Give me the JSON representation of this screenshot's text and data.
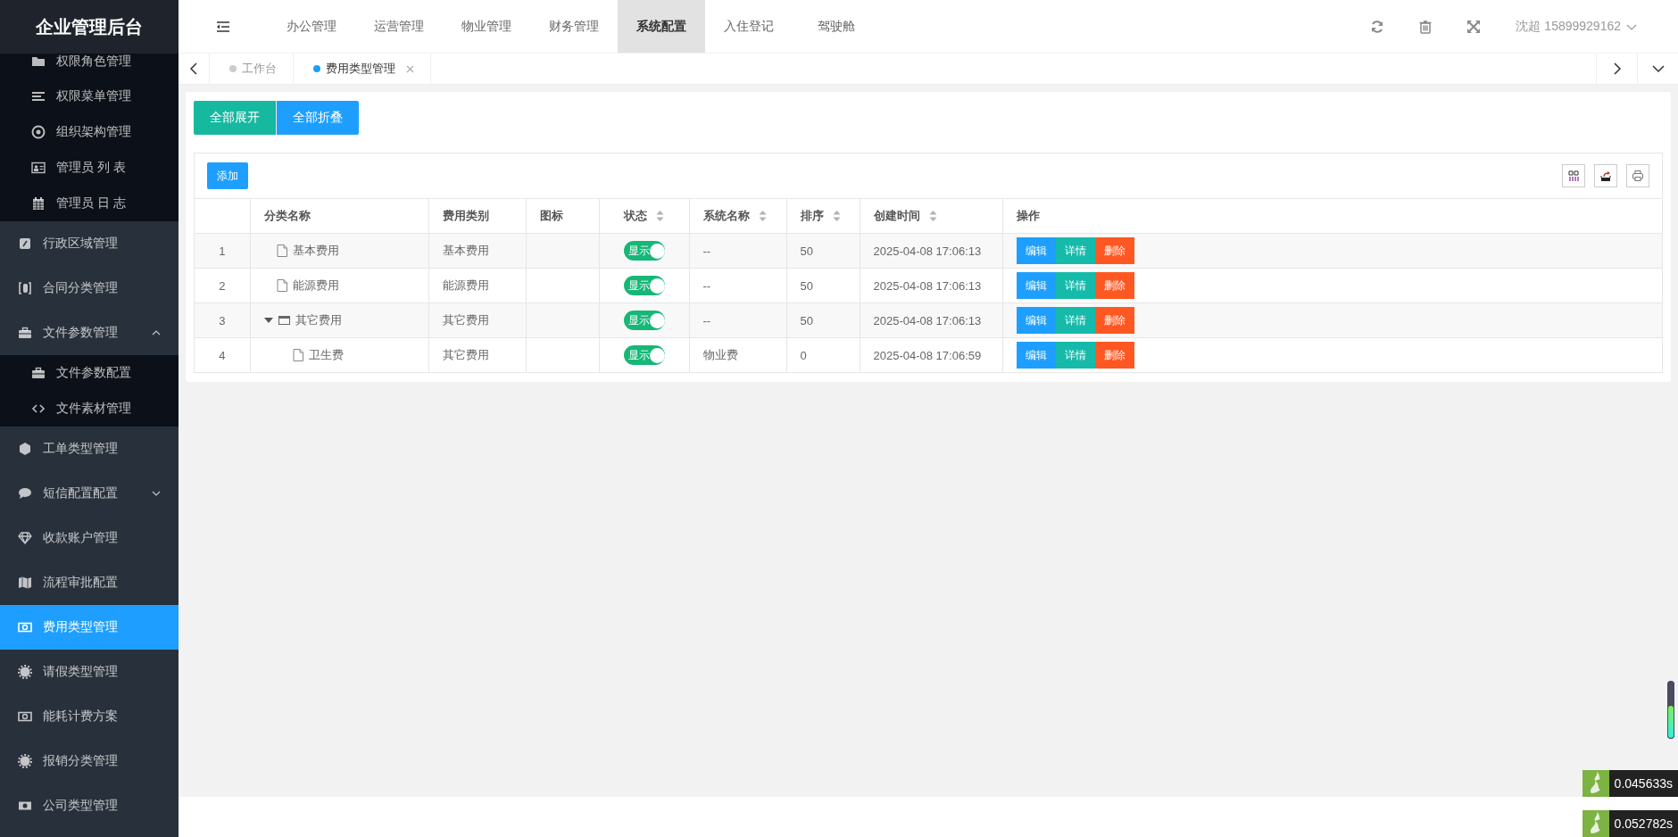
{
  "app": {
    "title": "企业管理后台"
  },
  "sidebar": {
    "submenu_items": [
      {
        "label": "权限角色管理",
        "selected": false
      },
      {
        "label": "权限菜单管理",
        "selected": false
      },
      {
        "label": "组织架构管理",
        "selected": false
      },
      {
        "label": "管理员 列 表",
        "selected": false
      },
      {
        "label": "管理员 日 志",
        "selected": false
      }
    ],
    "items": [
      {
        "label": "行政区域管理",
        "selected": false
      },
      {
        "label": "合同分类管理",
        "selected": false
      },
      {
        "label": "文件参数管理",
        "selected": false,
        "expanded": true,
        "children": [
          {
            "label": "文件参数配置",
            "selected": false
          },
          {
            "label": "文件素材管理",
            "selected": false
          }
        ]
      },
      {
        "label": "工单类型管理",
        "selected": false
      },
      {
        "label": "短信配置配置",
        "selected": false,
        "expanded": false
      },
      {
        "label": "收款账户管理",
        "selected": false
      },
      {
        "label": "流程审批配置",
        "selected": false
      },
      {
        "label": "费用类型管理",
        "selected": true
      },
      {
        "label": "请假类型管理",
        "selected": false
      },
      {
        "label": "能耗计费方案",
        "selected": false
      },
      {
        "label": "报销分类管理",
        "selected": false
      },
      {
        "label": "公司类型管理",
        "selected": false
      }
    ]
  },
  "top_nav": {
    "tabs": [
      {
        "label": "办公管理",
        "selected": false
      },
      {
        "label": "运营管理",
        "selected": false
      },
      {
        "label": "物业管理",
        "selected": false
      },
      {
        "label": "财务管理",
        "selected": false
      },
      {
        "label": "系统配置",
        "selected": true
      },
      {
        "label": "入住登记",
        "selected": false
      },
      {
        "label": "驾驶舱",
        "selected": false
      }
    ],
    "user": "沈超 15899929162"
  },
  "page_tabs": [
    {
      "label": "工作台",
      "selected": false
    },
    {
      "label": "费用类型管理",
      "selected": true
    }
  ],
  "toolbar": {
    "buttons": [
      {
        "label": "全部展开",
        "kind": "expand"
      },
      {
        "label": "全部折叠",
        "kind": "collapse"
      }
    ]
  },
  "table": {
    "add_button": "添加",
    "columns": [
      {
        "sortable": false
      },
      {
        "label": "分类名称",
        "sortable": false
      },
      {
        "label": "费用类别",
        "sortable": false
      },
      {
        "label": "图标",
        "sortable": false
      },
      {
        "label": "状态",
        "sortable": true
      },
      {
        "label": "系统名称",
        "sortable": true
      },
      {
        "label": "排序",
        "sortable": true
      },
      {
        "label": "创建时间",
        "sortable": true
      },
      {
        "label": "操作",
        "sortable": false
      }
    ],
    "rows": [
      {
        "no": "1",
        "name": "基本费用",
        "category": "基本费用",
        "status": {
          "label": "显示",
          "on": true
        },
        "system_name": "--",
        "sort": "50",
        "created": "2025-04-08 17:06:13",
        "actions": [
          {
            "label": "编辑",
            "kind": "edit"
          },
          {
            "label": "详情",
            "kind": "detail"
          },
          {
            "label": "删除",
            "kind": "delete"
          }
        ]
      },
      {
        "no": "2",
        "name": "能源费用",
        "category": "能源费用",
        "status": {
          "label": "显示",
          "on": true
        },
        "system_name": "--",
        "sort": "50",
        "created": "2025-04-08 17:06:13",
        "actions": [
          {
            "label": "编辑",
            "kind": "edit"
          },
          {
            "label": "详情",
            "kind": "detail"
          },
          {
            "label": "删除",
            "kind": "delete"
          }
        ]
      },
      {
        "no": "3",
        "name": "其它费用",
        "category": "其它费用",
        "status": {
          "label": "显示",
          "on": true
        },
        "system_name": "--",
        "sort": "50",
        "created": "2025-04-08 17:06:13",
        "actions": [
          {
            "label": "编辑",
            "kind": "edit"
          },
          {
            "label": "详情",
            "kind": "detail"
          },
          {
            "label": "删除",
            "kind": "delete"
          }
        ],
        "expanded": true,
        "children": [
          {
            "no": "4",
            "name": "卫生费",
            "category": "其它费用",
            "status": {
              "label": "显示",
              "on": true
            },
            "system_name": "物业费",
            "sort": "0",
            "created": "2025-04-08 17:06:59",
            "actions": [
              {
                "label": "编辑",
                "kind": "edit"
              },
              {
                "label": "详情",
                "kind": "detail"
              },
              {
                "label": "删除",
                "kind": "delete"
              }
            ]
          }
        ]
      }
    ]
  },
  "perf_badges": [
    "0.045633s",
    "0.052782s"
  ]
}
